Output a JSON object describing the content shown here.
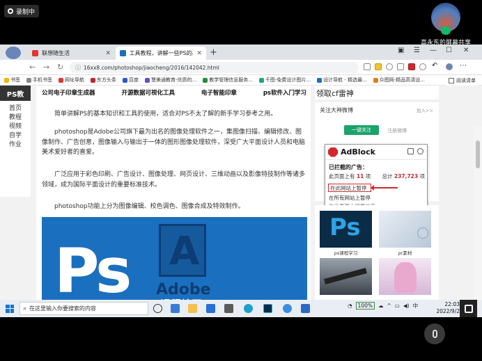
{
  "recording": {
    "label": "录制中"
  },
  "share": {
    "name": "高永东的屏幕共享"
  },
  "browser": {
    "tabs": [
      {
        "label": "联想随生活",
        "color": "#e3342f"
      },
      {
        "label": "工具教程，讲解一些PS的基础...",
        "color": "#1b6fbf"
      }
    ],
    "new_tab": "+",
    "url": "16xx8.com/photoshop/jiaocheng/2016/142042.html",
    "bookmarks": [
      {
        "label": "书签",
        "color": "#f5b400"
      },
      {
        "label": "手机书签",
        "color": "#888"
      },
      {
        "label": "网址导航",
        "color": "#e3342f"
      },
      {
        "label": "东方头条",
        "color": "#c0272d"
      },
      {
        "label": "百度",
        "color": "#2b59c3"
      },
      {
        "label": "慧美通教育-优质的...",
        "color": "#6a4cc9"
      },
      {
        "label": "教学管理信息服务...",
        "color": "#2a8a3a"
      },
      {
        "label": "千图-免费设计图片...",
        "color": "#1ea870"
      },
      {
        "label": "设计导航 - 精选最...",
        "color": "#1b6fbf"
      },
      {
        "label": "众图网-精品高清设...",
        "color": "#e37b1f"
      }
    ],
    "read_mode": "阅读清单"
  },
  "page": {
    "sidenav": {
      "title": "PS教",
      "items": [
        "首页",
        "教程",
        "视频",
        "自学",
        "作业"
      ]
    },
    "toplinks": [
      "公司电子印章生成器",
      "开源数据可视化工具",
      "电子智能印章",
      "ps软件入门学习"
    ],
    "paragraphs": [
      "简单讲解PS的基本知识和工具的使用，适合对PS不太了解的新手学习参考之用。",
      "photoshop是Adobe公司旗下最为出名的图像处理软件之一，集图像扫描、编辑修改、图像制作、广告创意，图像输入与输出于一体的图形图像处理软件，深受广大平面设计人员和电脑美术爱好者的喜爱。",
      "广泛应用于彩色印刷、广告设计、图像处理、网页设计、三维动画以及影像特技制作等诸多领域，成为国际平面设计的重要标准技术。",
      "photoshop功能上分为图像编辑、校色调色、图像合成及特效制作。"
    ],
    "banner": {
      "ps": "Ps",
      "a": "A",
      "adobe": "Adobe",
      "course": "课程绘画"
    },
    "right": {
      "title": "领取cf雷神",
      "follow_title": "关注大神微博",
      "follow_more": "加入>>",
      "follow_btn": "一键关注",
      "follow_btn2": "注册微博",
      "thumbs": [
        {
          "label": "ps课程学习",
          "icon": "ps-icon"
        },
        {
          "label": "pr素材",
          "icon": "snow-ornament"
        },
        {
          "label": "",
          "icon": "gun-image"
        },
        {
          "label": "",
          "icon": "anime-girl-image"
        }
      ]
    }
  },
  "adblock": {
    "name": "AdBlock",
    "blocked_title": "已拦截的广告：",
    "on_page": "此页面上有",
    "on_page_count": "11",
    "on_page_unit": "项",
    "total_label": "总计",
    "total_count": "237,723",
    "total_unit": "项",
    "pause_site": "在此网站上暂停",
    "pause_all": "在所有网站上暂停",
    "third": "在此页面上拦截广告"
  },
  "taskbar": {
    "search_placeholder": "在这里输入你要搜索的内容",
    "battery": "100%",
    "ime": "中",
    "time": "22:03",
    "date": "2022/9/2"
  }
}
